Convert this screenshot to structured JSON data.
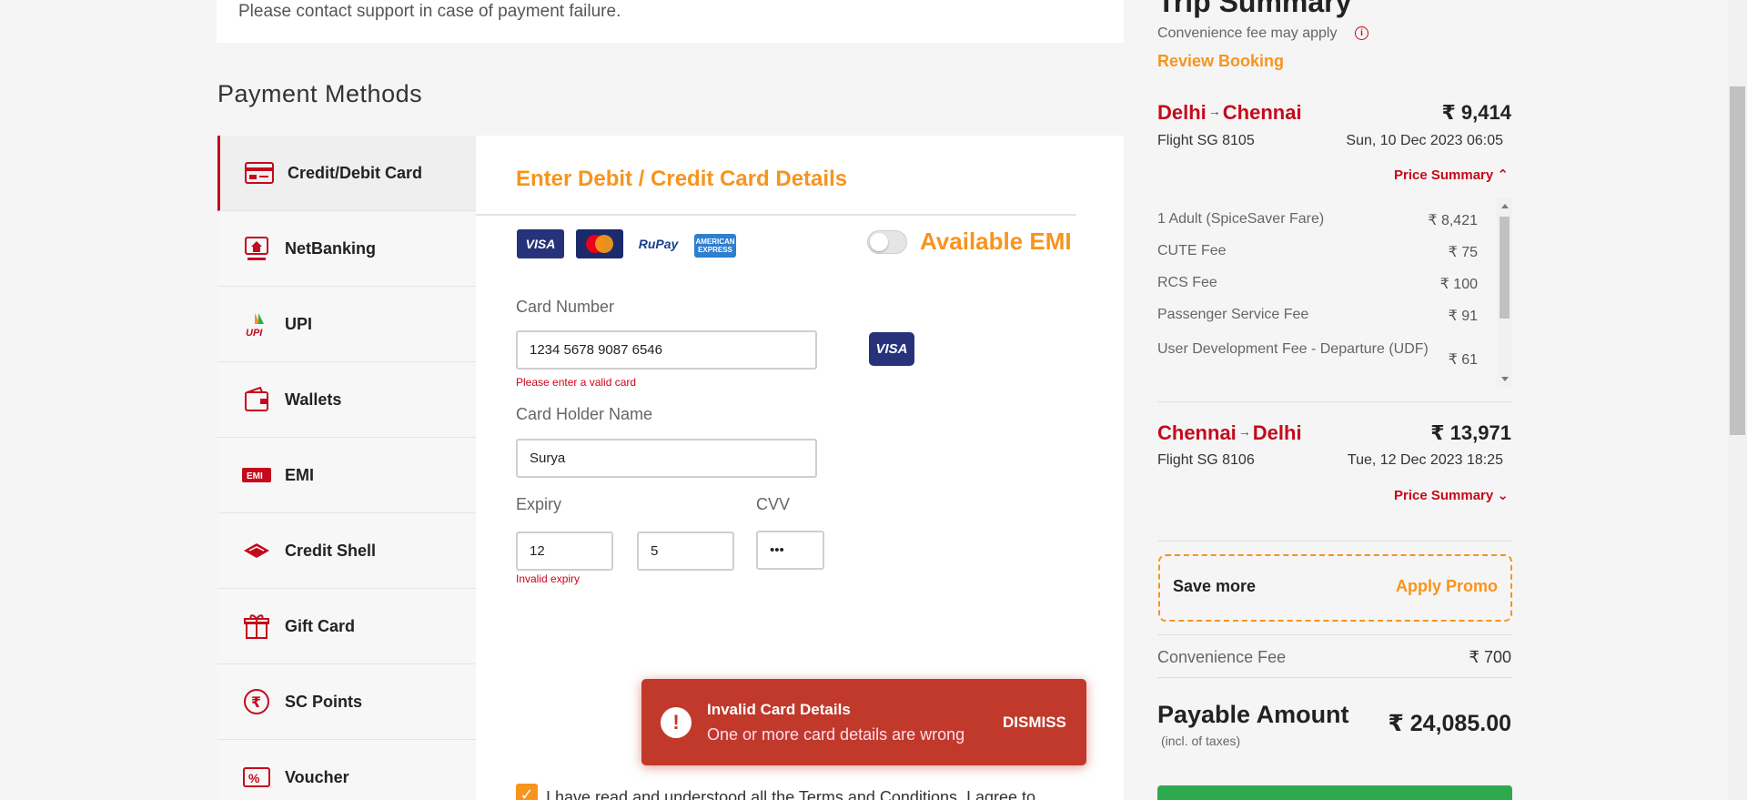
{
  "notice": {
    "text": "Please contact support in case of payment failure."
  },
  "payment_methods": {
    "title": "Payment Methods",
    "items": [
      {
        "label": "Credit/Debit Card",
        "icon": "card-icon",
        "active": true
      },
      {
        "label": "NetBanking",
        "icon": "bank-icon"
      },
      {
        "label": "UPI",
        "icon": "upi-icon"
      },
      {
        "label": "Wallets",
        "icon": "wallet-icon"
      },
      {
        "label": "EMI",
        "icon": "emi-icon"
      },
      {
        "label": "Credit Shell",
        "icon": "credit-shell-icon"
      },
      {
        "label": "Gift Card",
        "icon": "gift-icon"
      },
      {
        "label": "SC Points",
        "icon": "rupee-icon"
      },
      {
        "label": "Voucher",
        "icon": "voucher-icon"
      }
    ]
  },
  "card_form": {
    "title": "Enter Debit / Credit Card Details",
    "logos": {
      "visa": "VISA",
      "rupay": "RuPay",
      "amex": "AMERICAN EXPRESS"
    },
    "emi_label": "Available EMI",
    "card_number": {
      "label": "Card Number",
      "value": "1234 5678 9087 6546",
      "error": "Please enter a valid card",
      "brand": "VISA"
    },
    "holder": {
      "label": "Card Holder Name",
      "value": "Surya"
    },
    "expiry": {
      "label": "Expiry",
      "month": "12",
      "year": "5",
      "error": "Invalid expiry"
    },
    "cvv": {
      "label": "CVV",
      "value": "•••"
    },
    "terms": "I have read and understood all the Terms and Conditions. I agree to"
  },
  "toast": {
    "title": "Invalid Card Details",
    "message": "One or more card details are wrong",
    "dismiss": "DISMISS"
  },
  "summary": {
    "title": "Trip Summary",
    "conv_note": "Convenience fee may apply",
    "review": "Review Booking",
    "legs": [
      {
        "from": "Delhi",
        "to": "Chennai",
        "fare": "₹ 9,414",
        "flight": "Flight  SG 8105",
        "date": "Sun, 10 Dec 2023  06:05",
        "price_summary": "Price Summary"
      },
      {
        "from": "Chennai",
        "to": "Delhi",
        "fare": "₹ 13,971",
        "flight": "Flight  SG 8106",
        "date": "Tue, 12 Dec 2023  18:25",
        "price_summary": "Price Summary"
      }
    ],
    "breakdown": [
      {
        "label": "1 Adult  (SpiceSaver Fare)",
        "value": "₹ 8,421"
      },
      {
        "label": "CUTE Fee",
        "value": "₹ 75"
      },
      {
        "label": "RCS Fee",
        "value": "₹ 100"
      },
      {
        "label": "Passenger Service Fee",
        "value": "₹ 91"
      },
      {
        "label": "User Development Fee - Departure (UDF)",
        "value": "₹ 61"
      }
    ],
    "promo": {
      "save": "Save more",
      "apply": "Apply Promo"
    },
    "convenience_fee": {
      "label": "Convenience Fee",
      "value": "₹ 700"
    },
    "payable": {
      "label": "Payable Amount",
      "note": "(incl. of taxes)",
      "value": "₹ 24,085.00"
    }
  },
  "colors": {
    "brand_red": "#c40a1c",
    "accent_orange": "#f7941d",
    "error_toast": "#c0392b",
    "pay_green": "#2eaa4e"
  }
}
